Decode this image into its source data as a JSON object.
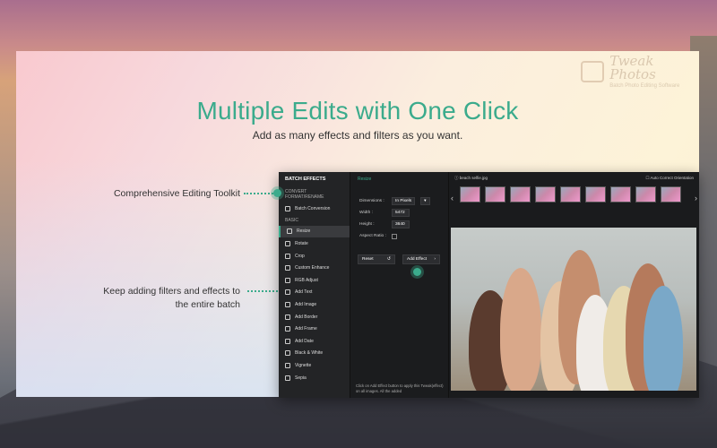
{
  "watermark": {
    "brand": "Tweak Photos",
    "tagline": "Batch Photo Editing Software"
  },
  "headline": "Multiple Edits with One Click",
  "subhead": "Add as many effects and filters as you want.",
  "callouts": {
    "toolkit": "Comprehensive Editing Toolkit",
    "batch_line1": "Keep adding filters and effects to",
    "batch_line2": "the entire batch"
  },
  "accent_color": "#3bab8c",
  "app": {
    "sidebar": {
      "title": "BATCH EFFECTS",
      "section_convert": "CONVERT FORMAT/RENAME",
      "batch_conversion": "Batch Conversion",
      "section_basic": "BASIC",
      "items": [
        {
          "label": "Resize",
          "icon": "resize-icon"
        },
        {
          "label": "Rotate",
          "icon": "rotate-icon"
        },
        {
          "label": "Crop",
          "icon": "crop-icon"
        },
        {
          "label": "Custom Enhance",
          "icon": "enhance-icon"
        },
        {
          "label": "RGB Adjust",
          "icon": "rgb-icon"
        },
        {
          "label": "Add Text",
          "icon": "text-icon"
        },
        {
          "label": "Add Image",
          "icon": "image-icon"
        },
        {
          "label": "Add Border",
          "icon": "border-icon"
        },
        {
          "label": "Add Frame",
          "icon": "frame-icon"
        },
        {
          "label": "Add Date",
          "icon": "date-icon"
        },
        {
          "label": "Black & White",
          "icon": "bw-icon"
        },
        {
          "label": "Vignette",
          "icon": "vignette-icon"
        },
        {
          "label": "Sepia",
          "icon": "sepia-icon"
        }
      ]
    },
    "settings": {
      "title": "Resize",
      "dimensions_label": "Dimensions :",
      "dimensions_value": "In Pixels",
      "width_label": "Width :",
      "width_value": "5472",
      "height_label": "Height :",
      "height_value": "3640",
      "aspect_label": "Aspect Ratio :",
      "reset_label": "Reset",
      "add_effect_label": "Add Effect",
      "note": "Click on Add Effect button to apply this Tweak(effect) on all images. All the added"
    },
    "preview": {
      "filename": "beach selfie.jpg",
      "auto_orientation": "Auto Correct Orientation"
    }
  }
}
